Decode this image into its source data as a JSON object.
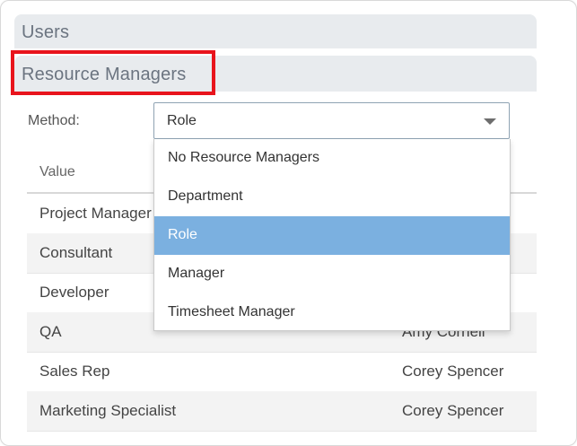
{
  "sections": {
    "users_title": "Users",
    "resource_managers_title": "Resource Managers"
  },
  "method": {
    "label": "Method:",
    "selected": "Role"
  },
  "dropdown": {
    "options": [
      "No Resource Managers",
      "Department",
      "Role",
      "Manager",
      "Timesheet Manager"
    ],
    "selected_index": 2
  },
  "table": {
    "headers": [
      "Value",
      ""
    ],
    "rows": [
      [
        "Project Manager",
        ""
      ],
      [
        "Consultant",
        ""
      ],
      [
        "Developer",
        ""
      ],
      [
        "QA",
        "Amy Cornell"
      ],
      [
        "Sales Rep",
        "Corey Spencer"
      ],
      [
        "Marketing Specialist",
        "Corey Spencer"
      ]
    ]
  },
  "colors": {
    "highlight_box": "#e8141c",
    "selected_option": "#7bb0e0",
    "section_bar": "#e8ebee"
  }
}
